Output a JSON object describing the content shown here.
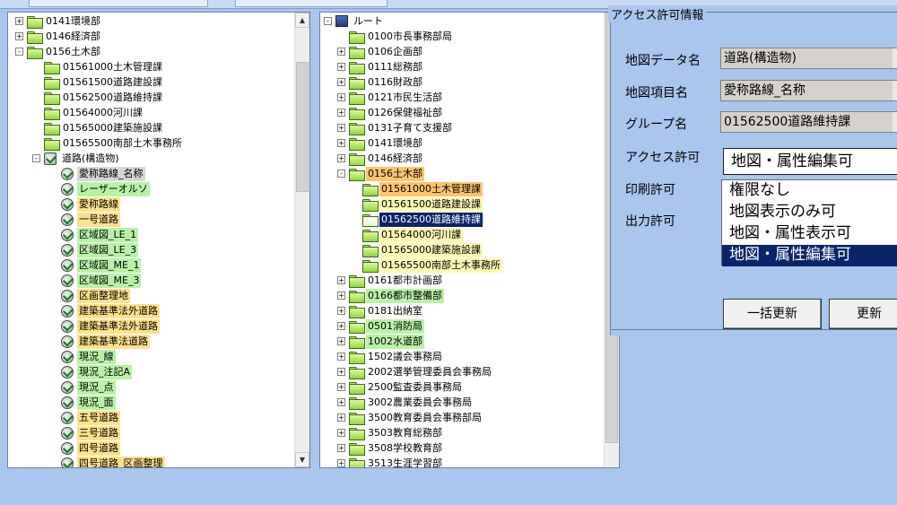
{
  "left_tree": [
    {
      "label": "0141環境部",
      "depth": 0,
      "exp": "+",
      "icon": "folder",
      "hl": ""
    },
    {
      "label": "0146経済部",
      "depth": 0,
      "exp": "+",
      "icon": "folder",
      "hl": ""
    },
    {
      "label": "0156土木部",
      "depth": 0,
      "exp": "-",
      "icon": "folder",
      "hl": ""
    },
    {
      "label": "01561000土木管理課",
      "depth": 1,
      "exp": "",
      "icon": "folder",
      "hl": ""
    },
    {
      "label": "01561500道路建設課",
      "depth": 1,
      "exp": "",
      "icon": "folder",
      "hl": ""
    },
    {
      "label": "01562500道路維持課",
      "depth": 1,
      "exp": "",
      "icon": "folder",
      "hl": ""
    },
    {
      "label": "01564000河川課",
      "depth": 1,
      "exp": "",
      "icon": "folder",
      "hl": ""
    },
    {
      "label": "01565000建築施設課",
      "depth": 1,
      "exp": "",
      "icon": "folder",
      "hl": ""
    },
    {
      "label": "01565500南部土木事務所",
      "depth": 1,
      "exp": "",
      "icon": "folder",
      "hl": ""
    },
    {
      "label": "道路(構造物)",
      "depth": 1,
      "exp": "-",
      "icon": "layers",
      "hl": ""
    },
    {
      "label": "愛称路線_名称",
      "depth": 2,
      "exp": "",
      "icon": "layer",
      "hl": "grey"
    },
    {
      "label": "レーザーオルソ",
      "depth": 2,
      "exp": "",
      "icon": "layer",
      "hl": "green"
    },
    {
      "label": "愛称路線",
      "depth": 2,
      "exp": "",
      "icon": "layer",
      "hl": "yellow"
    },
    {
      "label": "一号道路",
      "depth": 2,
      "exp": "",
      "icon": "layer",
      "hl": "yellow"
    },
    {
      "label": "区域図_LE_1",
      "depth": 2,
      "exp": "",
      "icon": "layer",
      "hl": "green"
    },
    {
      "label": "区域図_LE_3",
      "depth": 2,
      "exp": "",
      "icon": "layer",
      "hl": "green"
    },
    {
      "label": "区域図_ME_1",
      "depth": 2,
      "exp": "",
      "icon": "layer",
      "hl": "green"
    },
    {
      "label": "区域図_ME_3",
      "depth": 2,
      "exp": "",
      "icon": "layer",
      "hl": "green"
    },
    {
      "label": "区画整理地",
      "depth": 2,
      "exp": "",
      "icon": "layer",
      "hl": "yellow"
    },
    {
      "label": "建築基準法外道路",
      "depth": 2,
      "exp": "",
      "icon": "layer",
      "hl": "yellow"
    },
    {
      "label": "建築基準法外道路",
      "depth": 2,
      "exp": "",
      "icon": "layer",
      "hl": "yellow"
    },
    {
      "label": "建築基準法道路",
      "depth": 2,
      "exp": "",
      "icon": "layer",
      "hl": "yellow"
    },
    {
      "label": "現況_線",
      "depth": 2,
      "exp": "",
      "icon": "layer",
      "hl": "green"
    },
    {
      "label": "現況_注記A",
      "depth": 2,
      "exp": "",
      "icon": "layer",
      "hl": "green"
    },
    {
      "label": "現況_点",
      "depth": 2,
      "exp": "",
      "icon": "layer",
      "hl": "green"
    },
    {
      "label": "現況_面",
      "depth": 2,
      "exp": "",
      "icon": "layer",
      "hl": "green"
    },
    {
      "label": "五号道路",
      "depth": 2,
      "exp": "",
      "icon": "layer",
      "hl": "yellow"
    },
    {
      "label": "三号道路",
      "depth": 2,
      "exp": "",
      "icon": "layer",
      "hl": "yellow"
    },
    {
      "label": "四号道路",
      "depth": 2,
      "exp": "",
      "icon": "layer",
      "hl": "yellow"
    },
    {
      "label": "四号道路_区画整理",
      "depth": 2,
      "exp": "",
      "icon": "layer",
      "hl": "yellow"
    }
  ],
  "mid_tree": [
    {
      "label": "ルート",
      "depth": 0,
      "exp": "-",
      "icon": "pc",
      "hl": ""
    },
    {
      "label": "0100市長事務部局",
      "depth": 1,
      "exp": "",
      "icon": "folder",
      "hl": ""
    },
    {
      "label": "0106企画部",
      "depth": 1,
      "exp": "+",
      "icon": "folder",
      "hl": ""
    },
    {
      "label": "0111総務部",
      "depth": 1,
      "exp": "+",
      "icon": "folder",
      "hl": ""
    },
    {
      "label": "0116財政部",
      "depth": 1,
      "exp": "+",
      "icon": "folder",
      "hl": ""
    },
    {
      "label": "0121市民生活部",
      "depth": 1,
      "exp": "+",
      "icon": "folder",
      "hl": ""
    },
    {
      "label": "0126保健福祉部",
      "depth": 1,
      "exp": "+",
      "icon": "folder",
      "hl": ""
    },
    {
      "label": "0131子育て支援部",
      "depth": 1,
      "exp": "+",
      "icon": "folder",
      "hl": ""
    },
    {
      "label": "0141環境部",
      "depth": 1,
      "exp": "+",
      "icon": "folder",
      "hl": ""
    },
    {
      "label": "0146経済部",
      "depth": 1,
      "exp": "+",
      "icon": "folder",
      "hl": ""
    },
    {
      "label": "0156土木部",
      "depth": 1,
      "exp": "-",
      "icon": "folder",
      "hl": "orange"
    },
    {
      "label": "01561000土木管理課",
      "depth": 2,
      "exp": "",
      "icon": "folder",
      "hl": "orange"
    },
    {
      "label": "01561500道路建設課",
      "depth": 2,
      "exp": "",
      "icon": "folder",
      "hl": "lyellow"
    },
    {
      "label": "01562500道路維持課",
      "depth": 2,
      "exp": "",
      "icon": "folderopen",
      "hl": "select"
    },
    {
      "label": "01564000河川課",
      "depth": 2,
      "exp": "",
      "icon": "folder",
      "hl": "lyellow"
    },
    {
      "label": "01565000建築施設課",
      "depth": 2,
      "exp": "",
      "icon": "folder",
      "hl": "lyellow"
    },
    {
      "label": "01565500南部土木事務所",
      "depth": 2,
      "exp": "",
      "icon": "folder",
      "hl": "lyellow"
    },
    {
      "label": "0161都市計画部",
      "depth": 1,
      "exp": "+",
      "icon": "folder",
      "hl": ""
    },
    {
      "label": "0166都市整備部",
      "depth": 1,
      "exp": "+",
      "icon": "folder",
      "hl": "green"
    },
    {
      "label": "0181出納室",
      "depth": 1,
      "exp": "+",
      "icon": "folder",
      "hl": ""
    },
    {
      "label": "0501消防局",
      "depth": 1,
      "exp": "+",
      "icon": "folder",
      "hl": "green"
    },
    {
      "label": "1002水道部",
      "depth": 1,
      "exp": "+",
      "icon": "folder",
      "hl": "green"
    },
    {
      "label": "1502議会事務局",
      "depth": 1,
      "exp": "+",
      "icon": "folder",
      "hl": ""
    },
    {
      "label": "2002選挙管理委員会事務局",
      "depth": 1,
      "exp": "+",
      "icon": "folder",
      "hl": ""
    },
    {
      "label": "2500監査委員事務局",
      "depth": 1,
      "exp": "+",
      "icon": "folder",
      "hl": ""
    },
    {
      "label": "3002農業委員会事務局",
      "depth": 1,
      "exp": "+",
      "icon": "folder",
      "hl": ""
    },
    {
      "label": "3500教育委員会事務部局",
      "depth": 1,
      "exp": "+",
      "icon": "folder",
      "hl": ""
    },
    {
      "label": "3503教育総務部",
      "depth": 1,
      "exp": "+",
      "icon": "folder",
      "hl": ""
    },
    {
      "label": "3508学校教育部",
      "depth": 1,
      "exp": "+",
      "icon": "folder",
      "hl": ""
    },
    {
      "label": "3513生涯学習部",
      "depth": 1,
      "exp": "+",
      "icon": "folder",
      "hl": ""
    }
  ],
  "perm": {
    "title": "アクセス許可情報",
    "map_data_label": "地図データ名",
    "map_data_value": "道路(構造物)",
    "map_item_label": "地図項目名",
    "map_item_value": "愛称路線_名称",
    "group_label": "グループ名",
    "group_value": "01562500道路維持課",
    "access_label": "アクセス許可",
    "access_value": "地図・属性編集可",
    "print_label": "印刷許可",
    "output_label": "出力許可",
    "options": [
      "権限なし",
      "地図表示のみ可",
      "地図・属性表示可",
      "地図・属性編集可"
    ],
    "bulk_update": "一括更新",
    "update": "更新"
  }
}
